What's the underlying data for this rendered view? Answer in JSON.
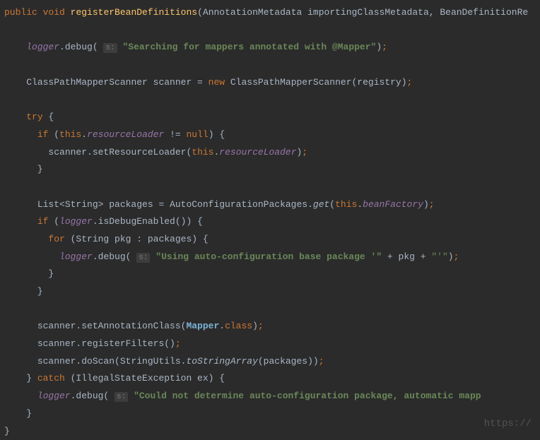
{
  "method": {
    "modifiers": "public void",
    "name": "registerBeanDefinitions",
    "params": "AnnotationMetadata importingClassMetadata, BeanDefinitionRe"
  },
  "lines": {
    "debug1_prefix": "logger",
    "debug1_call": ".debug(",
    "debug1_hint": "s:",
    "debug1_str": "\"Searching for mappers annotated with @Mapper\"",
    "scanner_decl": "ClassPathMapperScanner scanner = ",
    "scanner_new": "new",
    "scanner_rest": " ClassPathMapperScanner(registry)",
    "try_kw": "try",
    "if1_kw": "if",
    "if1_this": "this",
    "if1_field": "resourceLoader",
    "if1_null": "null",
    "setRL_call": "scanner.setResourceLoader(",
    "setRL_this": "this",
    "setRL_field": "resourceLoader",
    "list_decl": "List<String> packages = AutoConfigurationPackages.",
    "list_get": "get",
    "list_this": "this",
    "list_field": "beanFactory",
    "if2_kw": "if",
    "if2_logger": "logger",
    "if2_call": ".isDebugEnabled()) {",
    "for_kw": "for",
    "for_rest": " (String pkg : packages) {",
    "debug2_logger": "logger",
    "debug2_call": ".debug(",
    "debug2_hint": "s:",
    "debug2_str": "\"Using auto-configuration base package '\"",
    "debug2_plus": " + pkg + ",
    "debug2_str2": "\"'\"",
    "setAnno": "scanner.setAnnotationClass(",
    "mapper": "Mapper",
    "class_kw": "class",
    "regFilters": "scanner.registerFilters()",
    "doScan1": "scanner.doScan(StringUtils.",
    "doScan_italic": "toStringArray",
    "doScan2": "(packages))",
    "catch_kw": "catch",
    "catch_rest": " (IllegalStateException ex) {",
    "debug3_logger": "logger",
    "debug3_call": ".debug(",
    "debug3_hint": "s:",
    "debug3_str": "\"Could not determine auto-configuration package, automatic mapp"
  },
  "watermark": "https://"
}
